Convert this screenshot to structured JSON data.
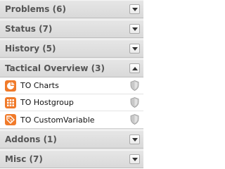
{
  "sections": [
    {
      "title": "Problems (6)",
      "expanded": false
    },
    {
      "title": "Status (7)",
      "expanded": false
    },
    {
      "title": "History (5)",
      "expanded": false
    },
    {
      "title": "Tactical Overview (3)",
      "expanded": true,
      "items": [
        {
          "label": "TO Charts",
          "icon": "chart-icon"
        },
        {
          "label": "TO Hostgroup",
          "icon": "grid-icon"
        },
        {
          "label": "TO CustomVariable",
          "icon": "tag-icon"
        }
      ]
    },
    {
      "title": "Addons (1)",
      "expanded": false
    },
    {
      "title": "Misc (7)",
      "expanded": false
    }
  ],
  "colors": {
    "icon_orange": "#f07a2a",
    "header_text": "#555555"
  }
}
